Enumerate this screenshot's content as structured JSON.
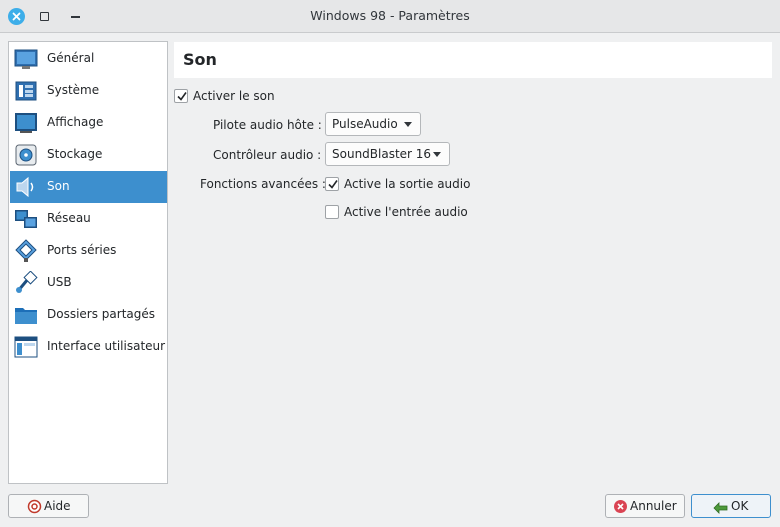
{
  "window": {
    "title": "Windows 98 - Paramètres"
  },
  "sidebar": {
    "items": [
      {
        "label": "Général",
        "icon": "general-icon"
      },
      {
        "label": "Système",
        "icon": "system-icon"
      },
      {
        "label": "Affichage",
        "icon": "display-icon"
      },
      {
        "label": "Stockage",
        "icon": "storage-icon"
      },
      {
        "label": "Son",
        "icon": "sound-icon",
        "selected": true
      },
      {
        "label": "Réseau",
        "icon": "network-icon"
      },
      {
        "label": "Ports séries",
        "icon": "serial-ports-icon"
      },
      {
        "label": "USB",
        "icon": "usb-icon"
      },
      {
        "label": "Dossiers partagés",
        "icon": "shared-folders-icon"
      },
      {
        "label": "Interface utilisateur",
        "icon": "user-interface-icon"
      }
    ]
  },
  "page": {
    "title": "Son",
    "enable_audio": {
      "label": "Activer le son",
      "checked": true
    },
    "host_driver": {
      "label": "Pilote audio hôte :",
      "value": "PulseAudio"
    },
    "controller": {
      "label": "Contrôleur audio :",
      "value": "SoundBlaster 16"
    },
    "advanced": {
      "label": "Fonctions avancées :",
      "output": {
        "label": "Active la sortie audio",
        "checked": true
      },
      "input": {
        "label": "Active l'entrée audio",
        "checked": false
      }
    }
  },
  "buttons": {
    "help": "Aide",
    "cancel": "Annuler",
    "ok": "OK"
  },
  "colors": {
    "selection": "#3d8fce",
    "accent": "#3daee9"
  }
}
